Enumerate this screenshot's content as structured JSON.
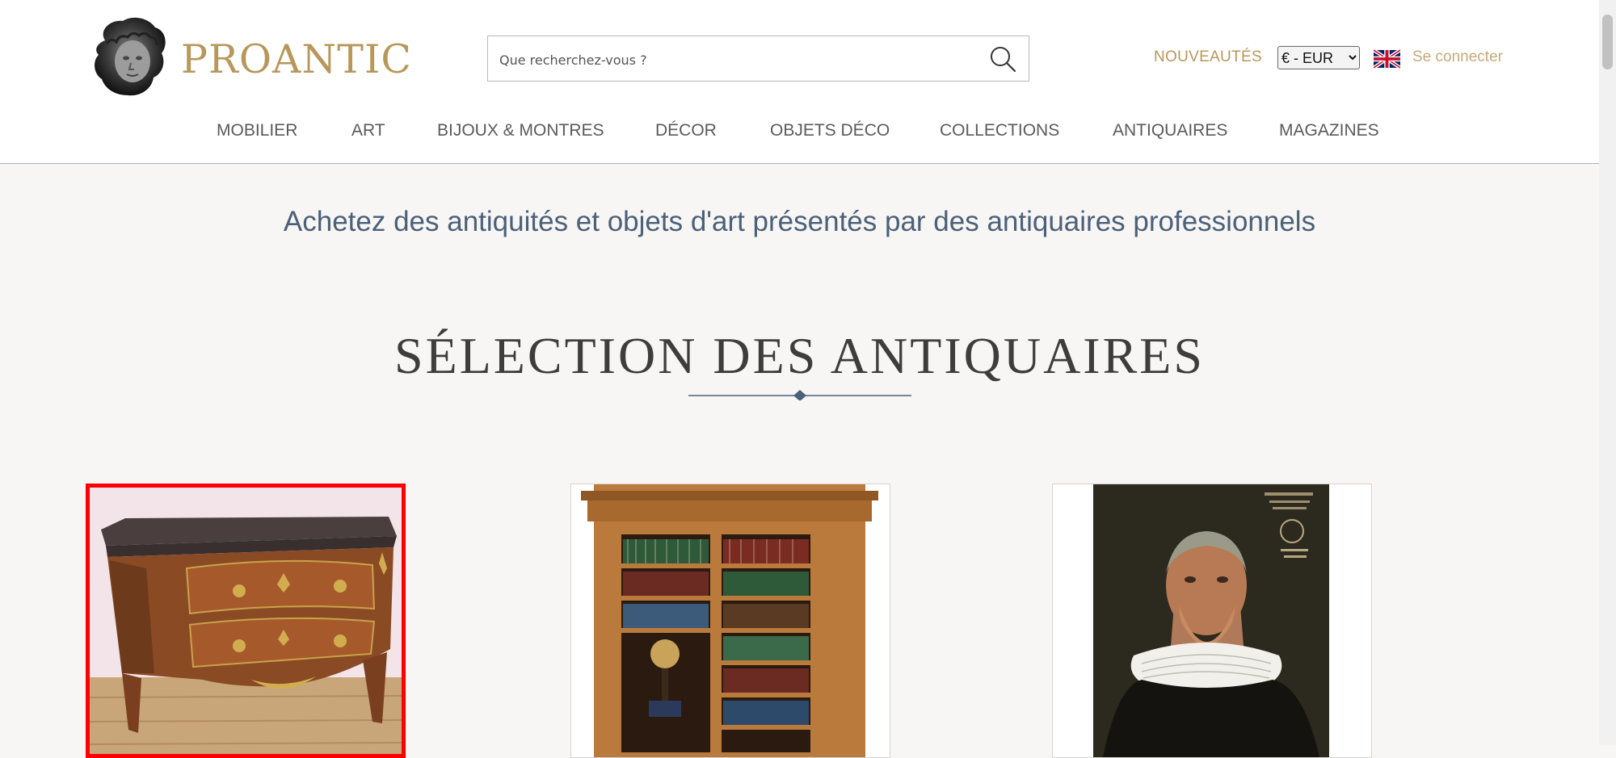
{
  "header": {
    "logo_text": "PROANTIC",
    "search": {
      "placeholder": "Que recherchez-vous ?",
      "value": ""
    },
    "nouveautes_label": "NOUVEAUTÉS",
    "currency": {
      "selected": "€ - EUR"
    },
    "language_flag": "uk-flag-icon",
    "login_label": "Se connecter",
    "accent_color": "#b8975a"
  },
  "nav": {
    "items": [
      {
        "label": "MOBILIER"
      },
      {
        "label": "ART"
      },
      {
        "label": "BIJOUX & MONTRES"
      },
      {
        "label": "DÉCOR"
      },
      {
        "label": "OBJETS DÉCO"
      },
      {
        "label": "COLLECTIONS"
      },
      {
        "label": "ANTIQUAIRES"
      },
      {
        "label": "MAGAZINES"
      }
    ]
  },
  "main": {
    "tagline": "Achetez des antiquités et objets d'art présentés par des antiquaires professionnels",
    "section_title": "SÉLECTION DES ANTIQUAIRES",
    "products": [
      {
        "image": "louis-xv-commode",
        "selected": true
      },
      {
        "image": "bookcase-cabinet",
        "selected": false
      },
      {
        "image": "portrait-painting",
        "selected": false
      }
    ]
  }
}
